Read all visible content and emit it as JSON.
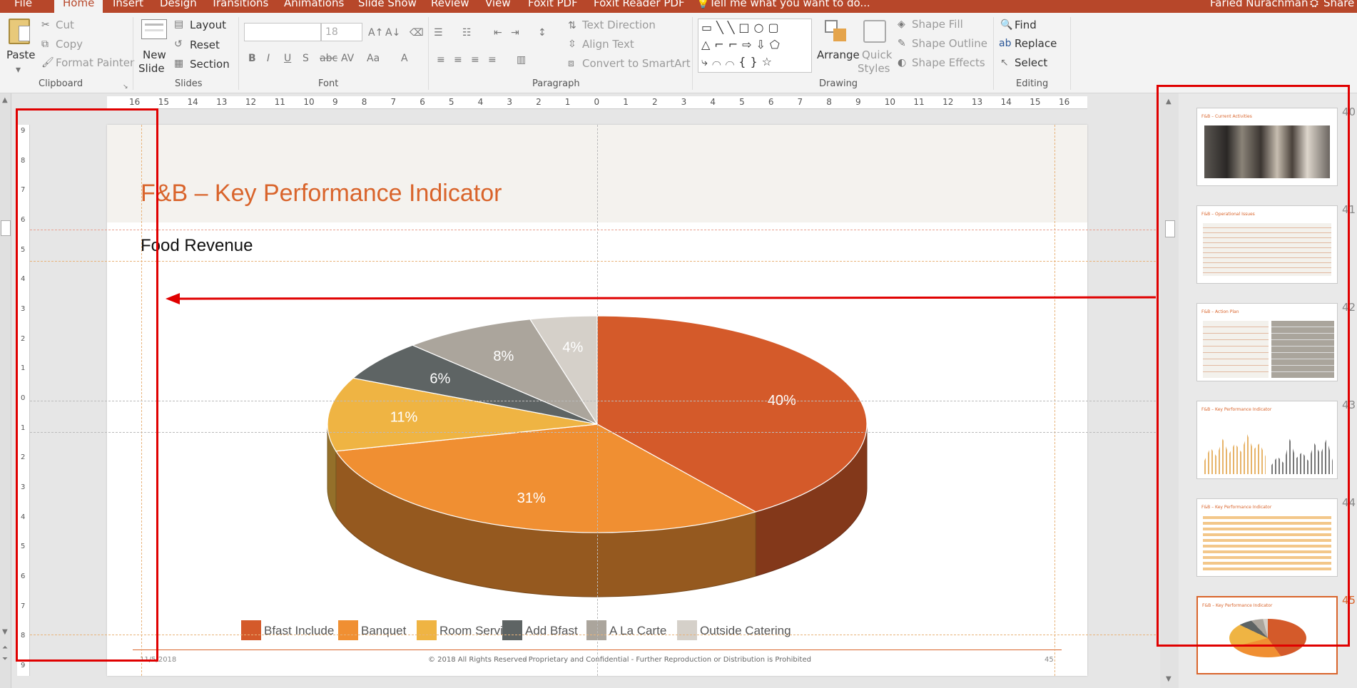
{
  "tabs": [
    "File",
    "Home",
    "Insert",
    "Design",
    "Transitions",
    "Animations",
    "Slide Show",
    "Review",
    "View",
    "Foxit PDF",
    "Foxit Reader PDF"
  ],
  "tell_me": "Tell me what you want to do...",
  "user": "Faried Nurachman",
  "share": "Share",
  "clipboard": {
    "paste": "Paste",
    "cut": "Cut",
    "copy": "Copy",
    "format_painter": "Format Painter",
    "group": "Clipboard"
  },
  "slides_grp": {
    "new_slide_1": "New",
    "new_slide_2": "Slide",
    "layout": "Layout",
    "reset": "Reset",
    "section": "Section",
    "group": "Slides"
  },
  "font": {
    "size": "18",
    "group": "Font"
  },
  "paragraph": {
    "text_direction": "Text Direction",
    "align_text": "Align Text",
    "smartart": "Convert to SmartArt",
    "group": "Paragraph"
  },
  "drawing": {
    "arrange": "Arrange",
    "quick_1": "Quick",
    "quick_2": "Styles",
    "fill": "Shape Fill",
    "outline": "Shape Outline",
    "effects": "Shape Effects",
    "group": "Drawing"
  },
  "editing": {
    "find": "Find",
    "replace": "Replace",
    "select": "Select",
    "group": "Editing"
  },
  "hruler": [
    "16",
    "15",
    "14",
    "13",
    "12",
    "11",
    "10",
    "9",
    "8",
    "7",
    "6",
    "5",
    "4",
    "3",
    "2",
    "1",
    "0",
    "1",
    "2",
    "3",
    "4",
    "5",
    "6",
    "7",
    "8",
    "9",
    "10",
    "11",
    "12",
    "13",
    "14",
    "15",
    "16"
  ],
  "vruler": [
    "9",
    "8",
    "7",
    "6",
    "5",
    "4",
    "3",
    "2",
    "1",
    "0",
    "1",
    "2",
    "3",
    "4",
    "5",
    "6",
    "7",
    "8",
    "9"
  ],
  "slide": {
    "title": "F&B – Key Performance Indicator",
    "subtitle": "Food Revenue",
    "footer_date": "11/5/2018",
    "footer_copy": "© 2018 All Rights Reserved",
    "footer_conf": "- Proprietary and Confidential - Further Reproduction or Distribution is Prohibited",
    "footer_page": "45"
  },
  "chart_data": {
    "type": "pie",
    "title": "",
    "categories": [
      "Bfast Include",
      "Banquet",
      "Room Service",
      "Add Bfast",
      "A La Carte",
      "Outside Catering"
    ],
    "values": [
      40,
      31,
      11,
      6,
      8,
      4
    ],
    "labels": [
      "40%",
      "31%",
      "11%",
      "6%",
      "8%",
      "4%"
    ],
    "colors": [
      "#d45a2a",
      "#f08f32",
      "#efb443",
      "#5e6464",
      "#aba59c",
      "#d5d0c9"
    ],
    "legend": "bottom",
    "style": "3d"
  },
  "thumbnails": [
    {
      "num": "40",
      "title": "F&B – Current Activities"
    },
    {
      "num": "41",
      "title": "F&B – Operational Issues"
    },
    {
      "num": "42",
      "title": "F&B – Action Plan"
    },
    {
      "num": "43",
      "title": "F&B – Key Performance Indicator"
    },
    {
      "num": "44",
      "title": "F&B – Key Performance Indicator"
    },
    {
      "num": "45",
      "title": "F&B – Key Performance Indicator"
    }
  ],
  "colors": {
    "accent": "#b7472a",
    "title": "#d9642b",
    "annotation": "#e00000"
  }
}
